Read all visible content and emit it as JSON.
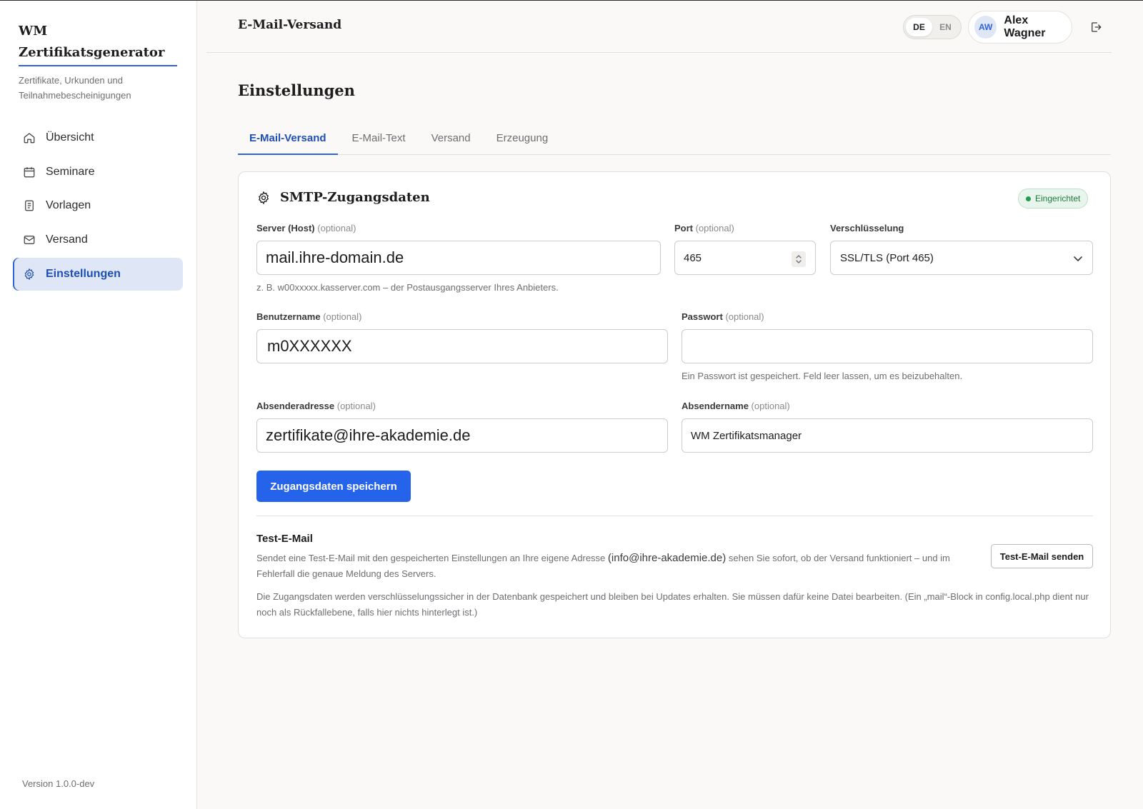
{
  "app": {
    "brand_line1": "WM",
    "brand_line2": "Zertifikatsgenerator",
    "brand_sub": "Zertifikate, Urkunden und Teilnahmebescheinigungen",
    "version": "Version 1.0.0-dev"
  },
  "sidebar": {
    "items": [
      {
        "label": "Übersicht",
        "icon": "home-icon",
        "active": false
      },
      {
        "label": "Seminare",
        "icon": "calendar-icon",
        "active": false
      },
      {
        "label": "Vorlagen",
        "icon": "document-icon",
        "active": false
      },
      {
        "label": "Versand",
        "icon": "mail-icon",
        "active": false
      },
      {
        "label": "Einstellungen",
        "icon": "gear-icon",
        "active": true
      }
    ]
  },
  "header": {
    "title": "E-Mail-Versand",
    "lang_de": "DE",
    "lang_en": "EN",
    "user_initials": "AW",
    "user_name": "Alex Wagner"
  },
  "page": {
    "title": "Einstellungen",
    "tabs": [
      {
        "label": "E-Mail-Versand",
        "active": true
      },
      {
        "label": "E-Mail-Text",
        "active": false
      },
      {
        "label": "Versand",
        "active": false
      },
      {
        "label": "Erzeugung",
        "active": false
      }
    ]
  },
  "smtp": {
    "title": "SMTP-Zugangsdaten",
    "status": "Eingerichtet",
    "optional": "(optional)",
    "host_label": "Server (Host)",
    "host_value": "mail.ihre-domain.de",
    "host_hint": "z. B. w00xxxxx.kasserver.com – der Postausgangsserver Ihres Anbieters.",
    "port_label": "Port",
    "port_value": "465",
    "encryption_label": "Verschlüsselung",
    "encryption_value": "SSL/TLS (Port 465)",
    "username_label": "Benutzername",
    "username_value": "m0XXXXXX",
    "password_label": "Passwort",
    "password_value": "",
    "password_hint": "Ein Passwort ist gespeichert. Feld leer lassen, um es beizubehalten.",
    "sender_address_label": "Absenderadresse",
    "sender_address_value": "zertifikate@ihre-akademie.de",
    "sender_name_label": "Absendername",
    "sender_name_value": "WM Zertifikatsmanager",
    "save_button": "Zugangsdaten speichern"
  },
  "test": {
    "title": "Test-E-Mail",
    "desc_part1": "Sendet eine Test-E-Mail mit den gespeicherten Einstellungen an Ihre eigene Adresse",
    "desc_mail": "(info@ihre-akademie.de)",
    "desc_part2": "sehen Sie sofort, ob der Versand funktioniert – und im Fehlerfall die genaue Meldung des Servers.",
    "button": "Test-E-Mail senden",
    "note": "Die Zugangsdaten werden verschlüsselungssicher in der Datenbank gespeichert und bleiben bei Updates erhalten. Sie müssen dafür keine Datei bearbeiten. (Ein „mail“-Block in config.local.php dient nur noch als Rückfallebene, falls hier nichts hinterlegt ist.)"
  },
  "colors": {
    "accent": "#2563eb",
    "active_bg": "#dfe7f7",
    "success": "#239b4e"
  }
}
